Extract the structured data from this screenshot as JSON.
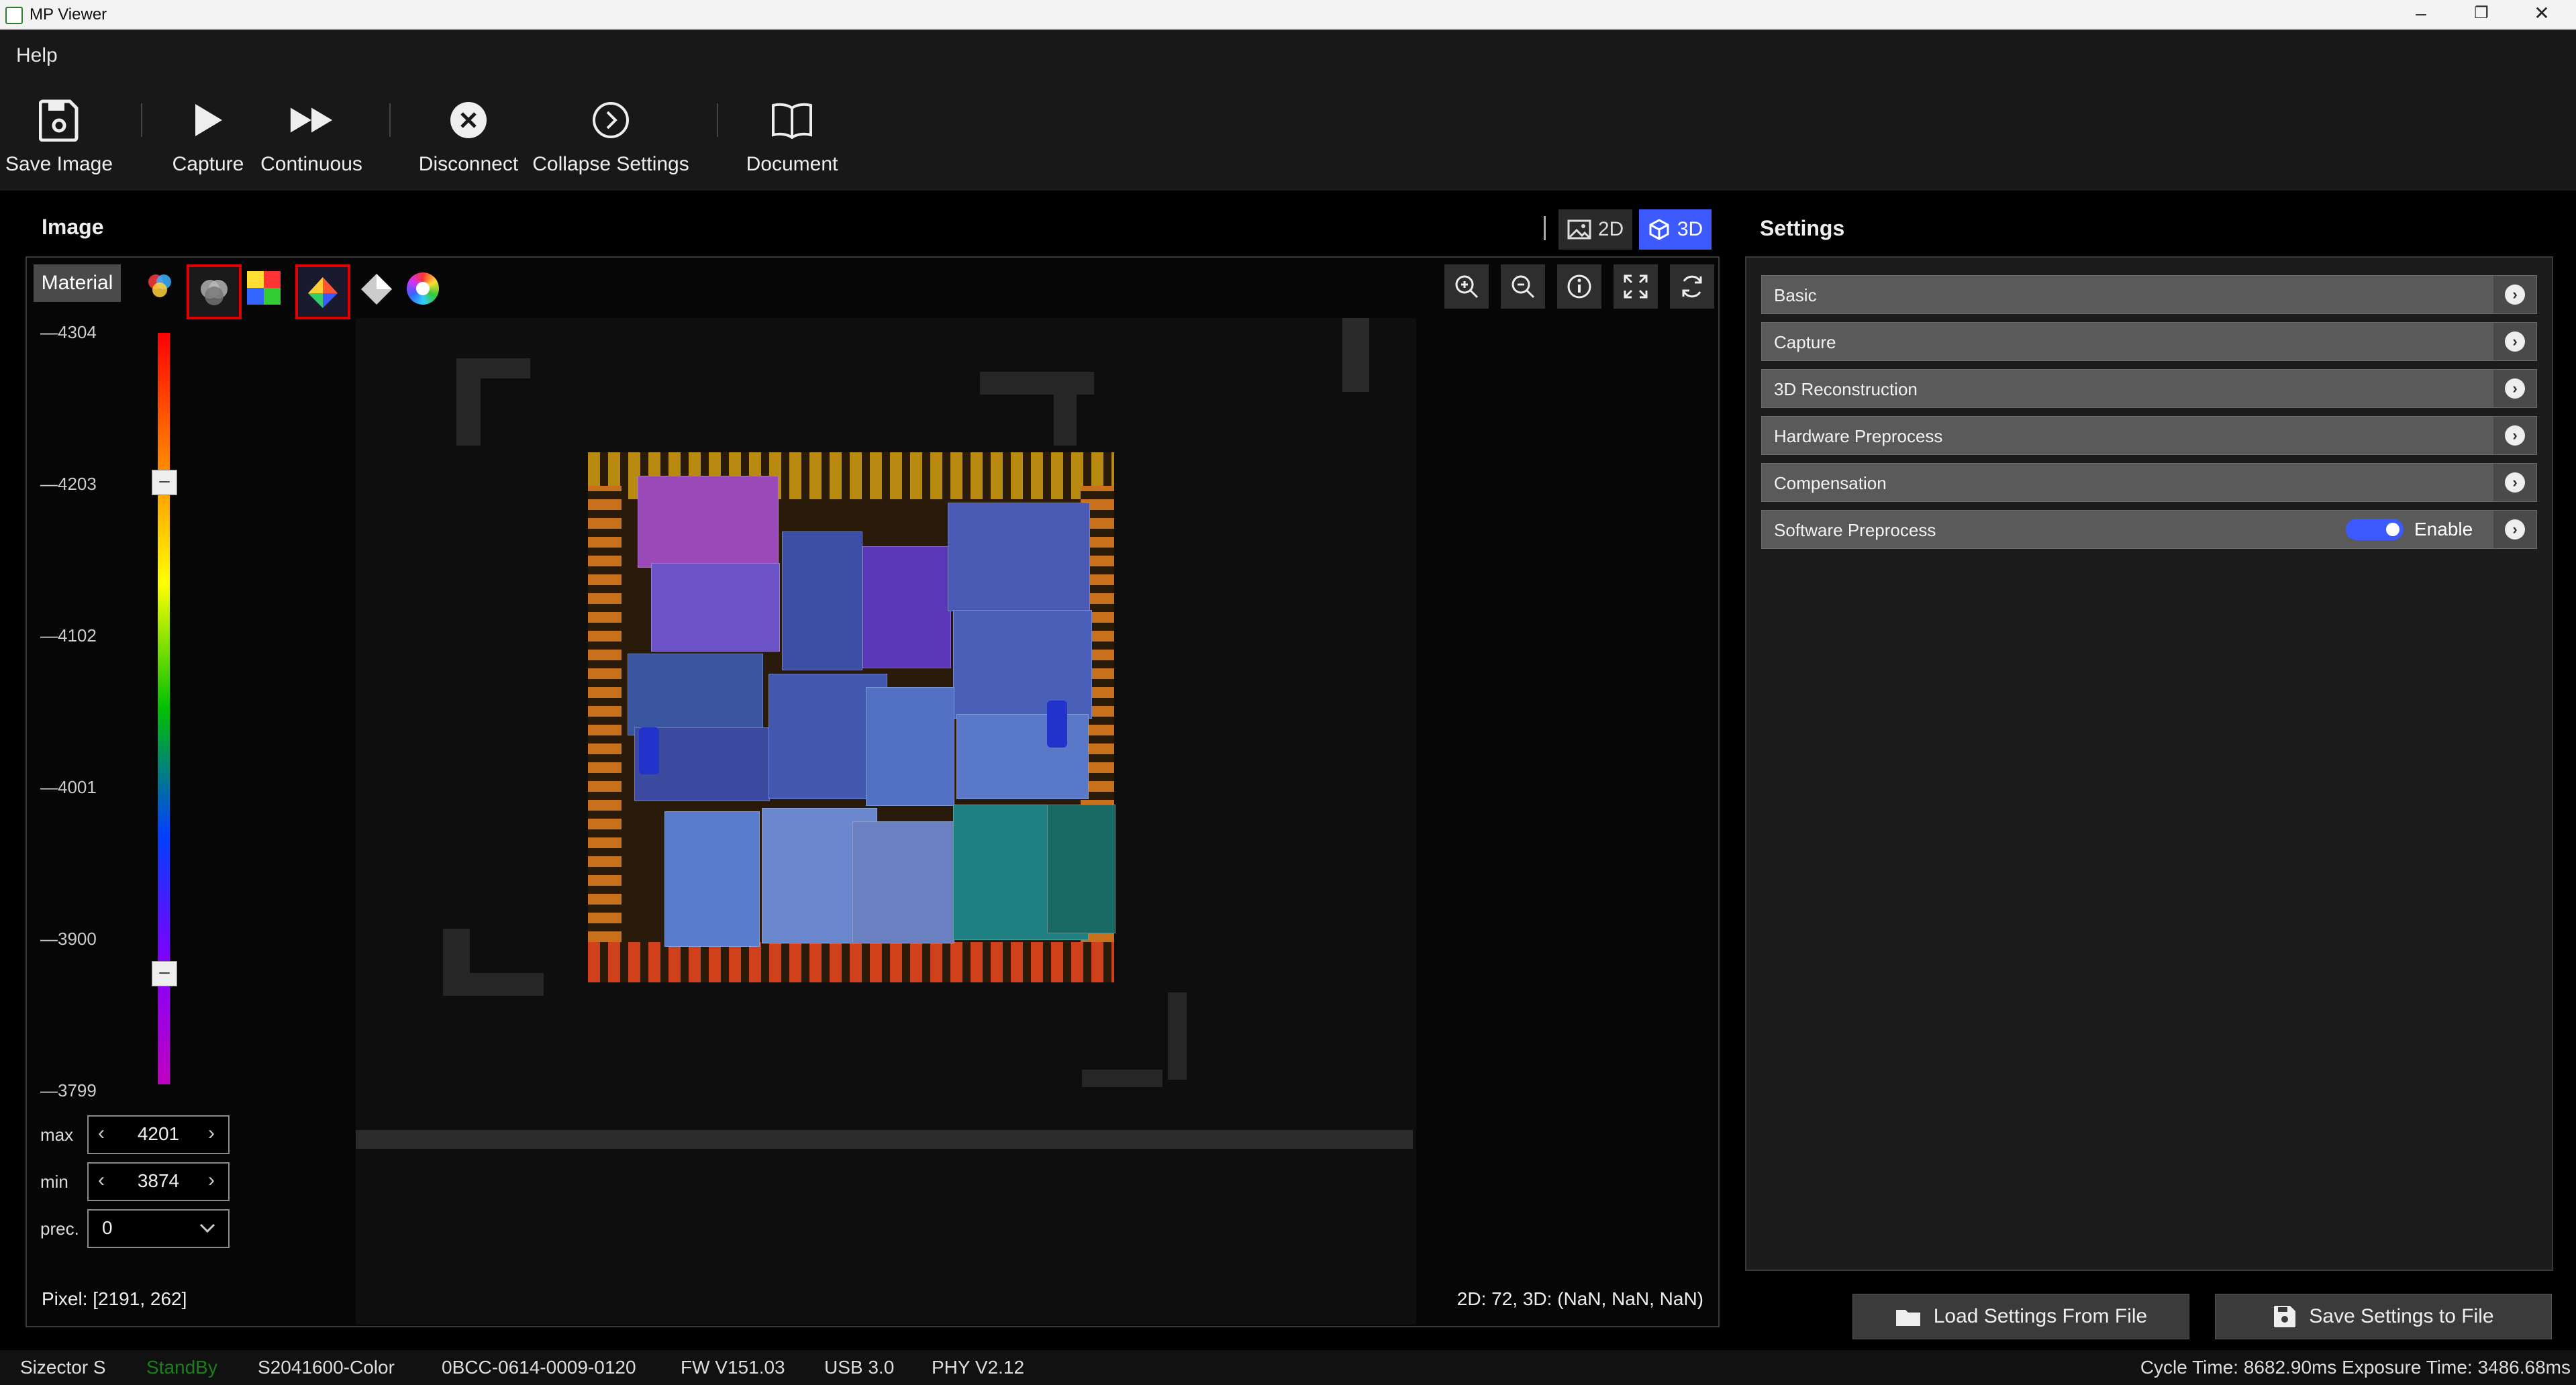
{
  "window": {
    "title": "MP Viewer",
    "controls": [
      "–",
      "❐",
      "✕"
    ]
  },
  "menu": {
    "help": "Help"
  },
  "toolbar": {
    "save_image": "Save Image",
    "capture": "Capture",
    "continuous": "Continuous",
    "disconnect": "Disconnect",
    "collapse_settings": "Collapse Settings",
    "document": "Document"
  },
  "image_panel": {
    "title": "Image",
    "mode_2d": "2D",
    "mode_3d": "3D",
    "mode_active": "3D",
    "material_label": "Material",
    "scale_ticks": [
      "4304",
      "4203",
      "4102",
      "4001",
      "3900",
      "3799"
    ],
    "max_label": "max",
    "max_value": "4201",
    "min_label": "min",
    "min_value": "3874",
    "prec_label": "prec.",
    "prec_value": "0",
    "pixel_readout": "Pixel: [2191, 262]",
    "point_readout": "2D: 72, 3D: (NaN, NaN, NaN)"
  },
  "settings": {
    "title": "Settings",
    "sections": [
      {
        "label": "Basic"
      },
      {
        "label": "Capture"
      },
      {
        "label": "3D Reconstruction"
      },
      {
        "label": "Hardware Preprocess"
      },
      {
        "label": "Compensation"
      },
      {
        "label": "Software Preprocess",
        "toggle_label": "Enable",
        "toggle_on": true
      }
    ],
    "load_button": "Load Settings From File",
    "save_button": "Save Settings to File"
  },
  "status": {
    "device": "Sizector S",
    "state": "StandBy",
    "state_color": "#1a7f1a",
    "model": "S2041600-Color",
    "serial": "0BCC-0614-0009-0120",
    "fw": "FW V151.03",
    "usb": "USB 3.0",
    "phy": "PHY V2.12",
    "timing": "Cycle Time: 8682.90ms Exposure Time: 3486.68ms"
  },
  "colors": {
    "accent": "#3d5afe",
    "panel": "#1c1c1c",
    "row": "#5a5a5a"
  }
}
